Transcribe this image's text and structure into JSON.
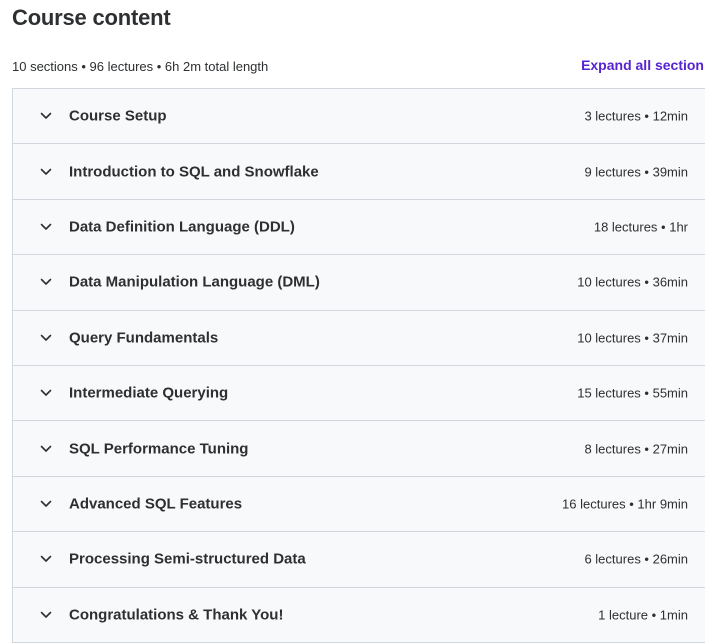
{
  "header": {
    "title": "Course content",
    "summary": "10 sections • 96 lectures • 6h 2m total length",
    "expand_label": "Expand all section"
  },
  "colors": {
    "accent": "#5624d0",
    "section_bg": "#f7f9fa",
    "border": "#d1d7dc",
    "text": "#2d2f31"
  },
  "sections": [
    {
      "title": "Course Setup",
      "meta": "3 lectures • 12min",
      "icon": "chevron-down-icon"
    },
    {
      "title": "Introduction to SQL and Snowflake",
      "meta": "9 lectures • 39min",
      "icon": "chevron-down-icon"
    },
    {
      "title": "Data Definition Language (DDL)",
      "meta": "18 lectures • 1hr",
      "icon": "chevron-down-icon"
    },
    {
      "title": "Data Manipulation Language (DML)",
      "meta": "10 lectures • 36min",
      "icon": "chevron-down-icon"
    },
    {
      "title": "Query Fundamentals",
      "meta": "10 lectures • 37min",
      "icon": "chevron-down-icon"
    },
    {
      "title": "Intermediate Querying",
      "meta": "15 lectures • 55min",
      "icon": "chevron-down-icon"
    },
    {
      "title": "SQL Performance Tuning",
      "meta": "8 lectures • 27min",
      "icon": "chevron-down-icon"
    },
    {
      "title": "Advanced SQL Features",
      "meta": "16 lectures • 1hr 9min",
      "icon": "chevron-down-icon"
    },
    {
      "title": "Processing Semi-structured Data",
      "meta": "6 lectures • 26min",
      "icon": "chevron-down-icon"
    },
    {
      "title": "Congratulations & Thank You!",
      "meta": "1 lecture • 1min",
      "icon": "chevron-down-icon"
    }
  ]
}
